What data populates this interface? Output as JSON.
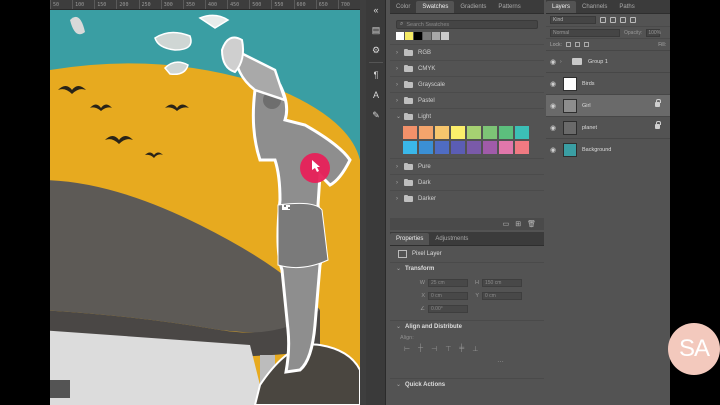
{
  "ruler_ticks": [
    "50",
    "100",
    "150",
    "200",
    "250",
    "300",
    "350",
    "400",
    "450",
    "500",
    "550",
    "600",
    "650",
    "700"
  ],
  "tools": [
    "double-arrow-icon",
    "comment-icon",
    "settings-icon",
    "paragraph-icon",
    "type-icon",
    "brush-icon"
  ],
  "swatches": {
    "tabs": [
      "Color",
      "Swatches",
      "Gradients",
      "Patterns"
    ],
    "active_tab": "Swatches",
    "search_placeholder": "Search Swatches",
    "recent_colors": [
      "#ffffff",
      "#f5ea64",
      "#000000",
      "#7a7a7a",
      "#a8a8a8",
      "#cccccc"
    ],
    "groups": [
      "RGB",
      "CMYK",
      "Grayscale",
      "Pastel",
      "Light",
      "Pure",
      "Dark",
      "Darker"
    ],
    "expanded_group": "Light",
    "light_colors": [
      "#f2916a",
      "#f3a46c",
      "#f7c66d",
      "#fcee6b",
      "#a6d172",
      "#7dc476",
      "#5cbf7d",
      "#3cbfb6",
      "#3ab7e9",
      "#3b8fd4",
      "#4f6cc3",
      "#5b5db4",
      "#7a5aa9",
      "#a05ba9",
      "#e177ab",
      "#f07a82"
    ]
  },
  "properties": {
    "tabs": [
      "Properties",
      "Adjustments"
    ],
    "active_tab": "Properties",
    "layer_kind": "Pixel Layer",
    "transform_title": "Transform",
    "w_label": "W",
    "h_label": "H",
    "x_label": "X",
    "y_label": "Y",
    "w_value": "25 cm",
    "h_value": "150 cm",
    "x_value": "0 cm",
    "y_value": "0 cm",
    "angle_value": "0.00°",
    "align_title": "Align and Distribute",
    "align_sub": "Align:",
    "quick_actions": "Quick Actions"
  },
  "layers": {
    "tabs": [
      "Layers",
      "Channels",
      "Paths"
    ],
    "active_tab": "Layers",
    "kind_filter": "Kind",
    "blend_mode": "Normal",
    "opacity_label": "Opacity:",
    "opacity_value": "100%",
    "lock_label": "Lock:",
    "fill_label": "Fill:",
    "items": [
      {
        "name": "Group 1",
        "type": "group",
        "selected": false,
        "locked": false
      },
      {
        "name": "Birds",
        "type": "layer",
        "selected": false,
        "locked": false
      },
      {
        "name": "Girl",
        "type": "layer",
        "selected": true,
        "locked": true
      },
      {
        "name": "planet",
        "type": "layer",
        "selected": false,
        "locked": true
      },
      {
        "name": "Background",
        "type": "layer",
        "selected": false,
        "locked": false
      }
    ]
  },
  "watermark": "SA"
}
